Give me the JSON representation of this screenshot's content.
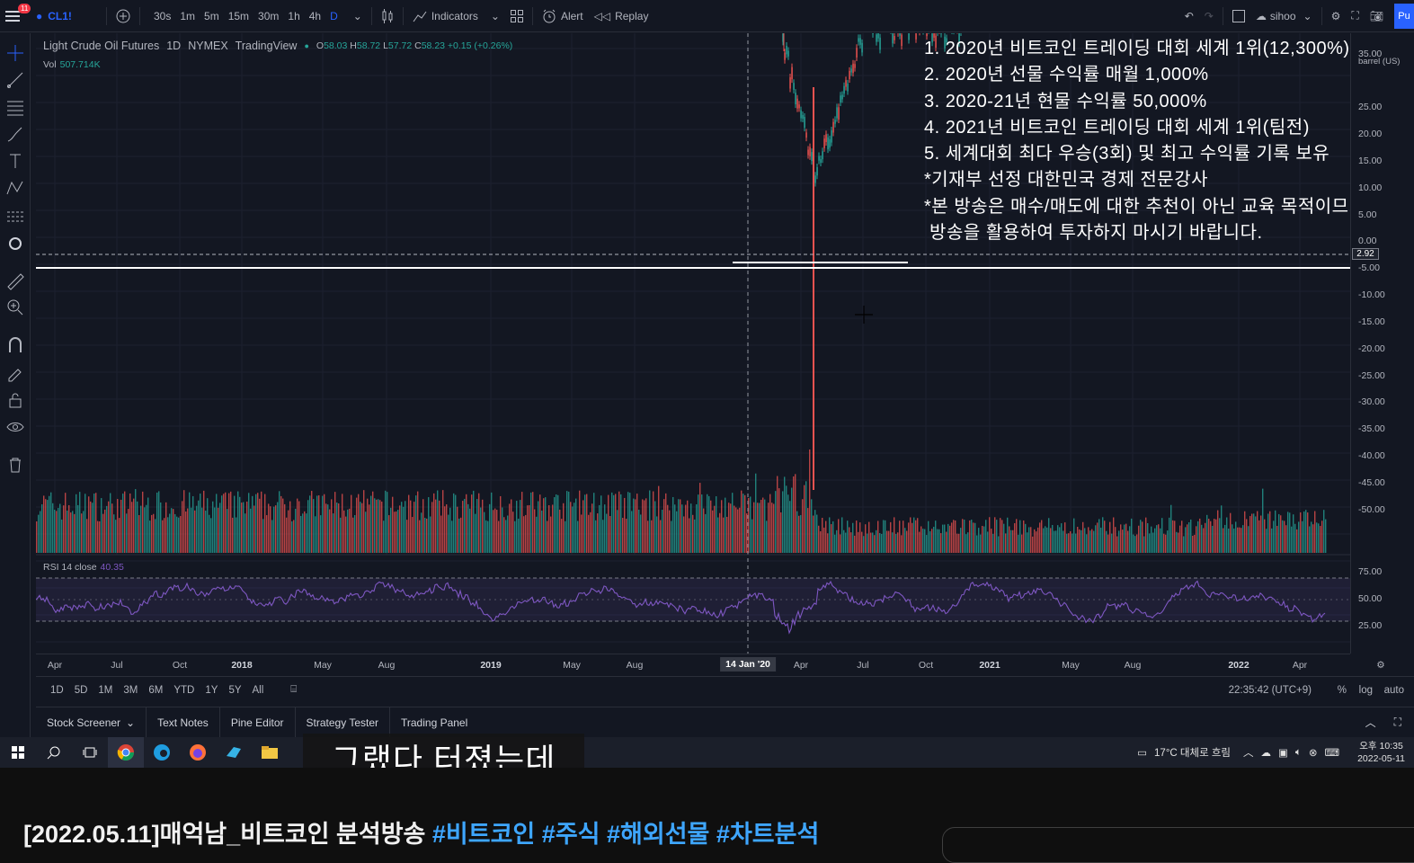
{
  "topbar": {
    "notification_count": "11",
    "symbol": "CL1!",
    "timeframes": [
      "30s",
      "1m",
      "5m",
      "15m",
      "30m",
      "1h",
      "4h",
      "D"
    ],
    "active_timeframe": "D",
    "indicators_label": "Indicators",
    "alert_label": "Alert",
    "replay_label": "Replay",
    "user": "sihoo",
    "publish_label": "Pu"
  },
  "legend": {
    "title": "Light Crude Oil Futures",
    "interval": "1D",
    "exchange": "NYMEX",
    "provider": "TradingView",
    "o_key": "O",
    "o_val": "58.03",
    "h_key": "H",
    "h_val": "58.72",
    "l_key": "L",
    "l_val": "57.72",
    "c_key": "C",
    "c_val": "58.23",
    "change": "+0.15 (+0.26%)",
    "vol_label": "Vol",
    "vol_value": "507.714K",
    "rsi_label": "RSI 14 close",
    "rsi_value": "40.35"
  },
  "price_axis": {
    "unit_label": "barrel (US)",
    "ticks": [
      "35.00",
      "25.00",
      "20.00",
      "15.00",
      "10.00",
      "5.00",
      "0.00",
      "-5.00",
      "-10.00",
      "-15.00",
      "-20.00",
      "-25.00",
      "-30.00",
      "-35.00",
      "-40.00",
      "-45.00",
      "-50.00"
    ],
    "current_price": "2.92",
    "rsi_ticks": [
      "75.00",
      "50.00",
      "25.00"
    ]
  },
  "time_axis": {
    "labels": [
      "Apr",
      "Jul",
      "Oct",
      "2018",
      "May",
      "Aug",
      "2019",
      "May",
      "Aug",
      "Apr",
      "Jul",
      "Oct",
      "2021",
      "May",
      "Aug",
      "2022",
      "Apr"
    ],
    "cursor_date": "14 Jan '20"
  },
  "range_bar": {
    "ranges": [
      "1D",
      "5D",
      "1M",
      "3M",
      "6M",
      "YTD",
      "1Y",
      "5Y",
      "All"
    ],
    "clock": "22:35:42 (UTC+9)",
    "percent": "%",
    "log": "log",
    "auto": "auto"
  },
  "bottom_tabs": [
    "Stock Screener",
    "Text Notes",
    "Pine Editor",
    "Strategy Tester",
    "Trading Panel"
  ],
  "overlay_lines": [
    "1. 2020년 비트코인 트레이딩 대회 세계 1위(12,300%)",
    "2. 2020년 선물 수익률 매월 1,000%",
    "3. 2020-21년 현물 수익률 50,000%",
    "4. 2021년 비트코인 트레이딩 대회 세계 1위(팀전)",
    "5. 세계대회 최다 우승(3회) 및 최고 수익률 기록 보유",
    "*기재부 선정 대한민국 경제 전문강사",
    "*본 방송은 매수/매도에 대한 추천이 아닌 교육 목적이므",
    " 방송을 활용하여 투자하지 마시기 바랍니다."
  ],
  "caption": "그랬다 터졌는데",
  "taskbar": {
    "weather": "17°C 대체로 흐림",
    "time": "오후 10:35",
    "date": "2022-05-11"
  },
  "video_title": {
    "main": "[2022.05.11]매억남_비트코인 분석방송 ",
    "tags": [
      "#비트코인",
      "#주식",
      "#해외선물",
      "#차트분석"
    ]
  },
  "colors": {
    "background": "#131722",
    "up": "#26a69a",
    "down": "#ef5350",
    "rsi": "#7e57c2",
    "accent": "#2962ff"
  }
}
